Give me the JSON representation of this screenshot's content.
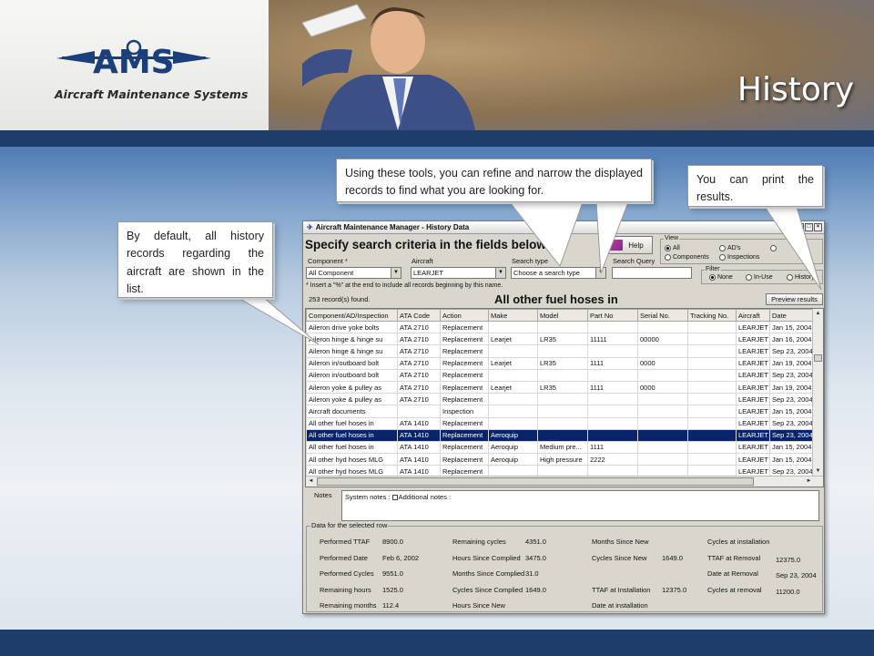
{
  "slide": {
    "title": "History",
    "logo_text": "AMS",
    "logo_subtitle": "Aircraft Maintenance Systems"
  },
  "callouts": {
    "default_list": "By default, all history records regarding the aircraft are shown in the list.",
    "tools": "Using these tools, you can refine and narrow the displayed records to find what you are looking for.",
    "print": "You can print the results."
  },
  "app": {
    "window_title": "Aircraft Maintenance Manager - History Data",
    "search_heading": "Specify search criteria in the fields below",
    "component_label": "Component",
    "component_required": "*",
    "component_value": "All Component",
    "aircraft_label": "Aircraft",
    "aircraft_value": "LEARJET",
    "search_type_label": "Search type",
    "search_type_value": "Choose a search type",
    "search_query_label": "Search Query",
    "search_query_value": "",
    "help_label": "Help",
    "view_label": "View",
    "view_options": [
      "All",
      "AD's",
      "Components",
      "Inspections"
    ],
    "view_selected": "All",
    "filter_label": "Filter",
    "filter_options": [
      "None",
      "In-Use",
      "History"
    ],
    "filter_selected": "None",
    "hint": "* Insert a \"%\" at the end to include all records beginning by this name.",
    "record_count": "253 record(s) found.",
    "selected_name": "All other fuel hoses in",
    "preview_label": "Preview results"
  },
  "grid": {
    "columns": [
      "Component/AD/Inspection",
      "ATA Code",
      "Action",
      "Make",
      "Model",
      "Part No",
      "Serial No.",
      "Tracking No.",
      "Aircraft",
      "Date"
    ],
    "rows": [
      [
        "Aileron drive yoke bolts",
        "ATA 2710",
        "Replacement",
        "",
        "",
        "",
        "",
        "",
        "LEARJET",
        "Jan 15, 2004"
      ],
      [
        "Aileron hinge & hinge su",
        "ATA 2710",
        "Replacement",
        "Learjet",
        "LR35",
        "11111",
        "00000",
        "",
        "LEARJET",
        "Jan 16, 2004"
      ],
      [
        "Aileron hinge & hinge su",
        "ATA 2710",
        "Replacement",
        "",
        "",
        "",
        "",
        "",
        "LEARJET",
        "Sep 23, 2004"
      ],
      [
        "Aileron in/outboard bolt",
        "ATA 2710",
        "Replacement",
        "Learjet",
        "LR35",
        "1111",
        "0000",
        "",
        "LEARJET",
        "Jan 19, 2004"
      ],
      [
        "Aileron in/outboard bolt",
        "ATA 2710",
        "Replacement",
        "",
        "",
        "",
        "",
        "",
        "LEARJET",
        "Sep 23, 2004"
      ],
      [
        "Aileron yoke & pulley as",
        "ATA 2710",
        "Replacement",
        "Learjet",
        "LR35",
        "1111",
        "0000",
        "",
        "LEARJET",
        "Jan 19, 2004"
      ],
      [
        "Aileron yoke & pulley as",
        "ATA 2710",
        "Replacement",
        "",
        "",
        "",
        "",
        "",
        "LEARJET",
        "Sep 23, 2004"
      ],
      [
        "Aircraft documents",
        "",
        "Inspection",
        "",
        "",
        "",
        "",
        "",
        "LEARJET",
        "Jan 15, 2004"
      ],
      [
        "All other fuel hoses in",
        "ATA 1410",
        "Replacement",
        "",
        "",
        "",
        "",
        "",
        "LEARJET",
        "Sep 23, 2004"
      ],
      [
        "All other fuel hoses in",
        "ATA 1410",
        "Replacement",
        "Aeroquip",
        "",
        "",
        "",
        "",
        "LEARJET",
        "Sep 23, 2004"
      ],
      [
        "All other fuel hoses in",
        "ATA 1410",
        "Replacement",
        "Aeroquip",
        "Medium pre...",
        "1111",
        "",
        "",
        "LEARJET",
        "Jan 15, 2004"
      ],
      [
        "All other hyd hoses MLG",
        "ATA 1410",
        "Replacement",
        "Aeroquip",
        "High pressure",
        "2222",
        "",
        "",
        "LEARJET",
        "Jan 15, 2004"
      ],
      [
        "All other hyd hoses MLG",
        "ATA 1410",
        "Replacement",
        "",
        "",
        "",
        "",
        "",
        "LEARJET",
        "Sep 23, 2004"
      ]
    ],
    "selected_row": 9
  },
  "notes": {
    "label": "Notes",
    "system_notes": "System notes :",
    "additional_notes": "Additional notes :"
  },
  "selected_data": {
    "group_label": "Data for the selected row",
    "col1": [
      {
        "label": "Performed TTAF",
        "value": "8900.0"
      },
      {
        "label": "Performed Date",
        "value": "Feb 6, 2002"
      },
      {
        "label": "Performed Cycles",
        "value": "9551.0"
      },
      {
        "label": "Remaining hours",
        "value": "1525.0"
      },
      {
        "label": "Remaining months",
        "value": "112.4"
      }
    ],
    "col2": [
      {
        "label": "Remaining cycles",
        "value": "4351.0"
      },
      {
        "label": "Hours Since Complied",
        "value": "3475.0"
      },
      {
        "label": "Months Since Complied",
        "value": "31.0"
      },
      {
        "label": "Cycles Since Complied",
        "value": "1649.0"
      },
      {
        "label": "Hours Since New",
        "value": ""
      }
    ],
    "col3": [
      {
        "label": "Months Since New",
        "value": ""
      },
      {
        "label": "Cycles Since New",
        "value": "1649.0"
      },
      {
        "label": "",
        "value": ""
      },
      {
        "label": "TTAF at Installation",
        "value": "12375.0"
      },
      {
        "label": "Date at installation",
        "value": ""
      }
    ],
    "col4": [
      {
        "label": "Cycles at installation",
        "value": ""
      },
      {
        "label": "TTAF at Removal",
        "value": "12375.0"
      },
      {
        "label": "Date at Removal",
        "value": "Sep 23, 2004"
      },
      {
        "label": "Cycles at removal",
        "value": "11200.0"
      },
      {
        "label": "",
        "value": ""
      }
    ]
  }
}
